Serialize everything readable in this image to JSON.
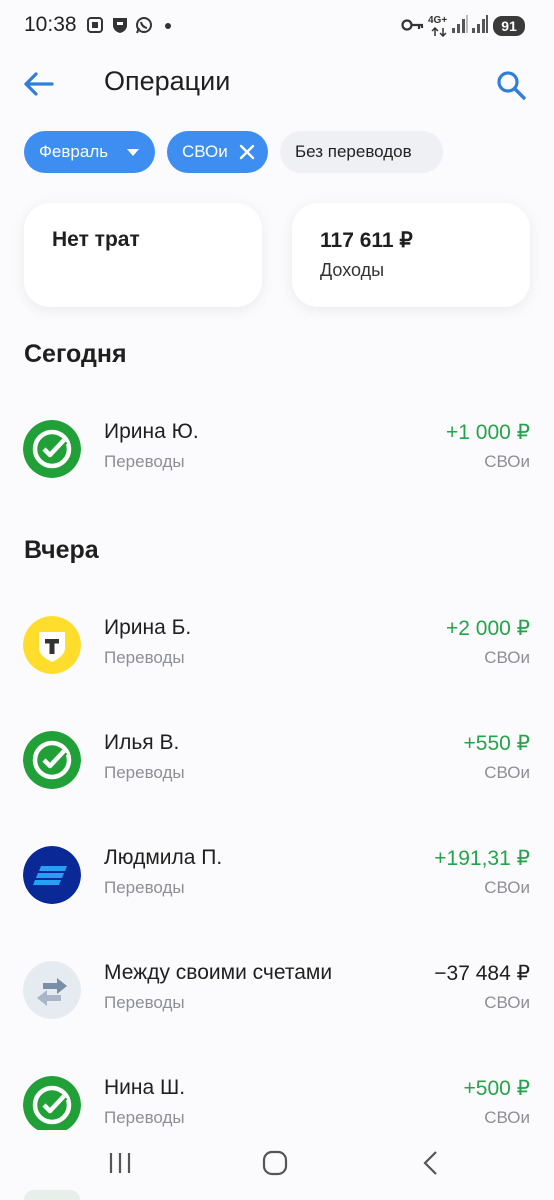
{
  "status_bar": {
    "time": "10:38",
    "network": "4G+",
    "battery": "91"
  },
  "header": {
    "title": "Операции"
  },
  "filters": [
    {
      "label": "Февраль"
    },
    {
      "label": "СВОи"
    },
    {
      "label": "Без переводов"
    }
  ],
  "summary": {
    "expenses": {
      "title": "Нет трат"
    },
    "income": {
      "amount": "117 611 ₽",
      "label": "Доходы"
    }
  },
  "sections": [
    {
      "title": "Сегодня",
      "items": [
        {
          "name": "Ирина Ю.",
          "category": "Переводы",
          "amount": "+1 000 ₽",
          "account": "СВОи",
          "icon": "sber-logo-icon"
        }
      ]
    },
    {
      "title": "Вчера",
      "items": [
        {
          "name": "Ирина Б.",
          "category": "Переводы",
          "amount": "+2 000 ₽",
          "account": "СВОи",
          "icon": "tbank-logo-icon"
        },
        {
          "name": "Илья В.",
          "category": "Переводы",
          "amount": "+550 ₽",
          "account": "СВОи",
          "icon": "sber-logo-icon"
        },
        {
          "name": "Людмила П.",
          "category": "Переводы",
          "amount": "+191,31 ₽",
          "account": "СВОи",
          "icon": "vtb-logo-icon"
        },
        {
          "name": "Между своими счетами",
          "category": "Переводы",
          "amount": "−37 484 ₽",
          "account": "СВОи",
          "icon": "transfer-arrows-icon"
        },
        {
          "name": "Нина Ш.",
          "category": "Переводы",
          "amount": "+500 ₽",
          "account": "СВОи",
          "icon": "sber-logo-icon"
        }
      ]
    }
  ],
  "colors": {
    "accent": "#3d8ef0",
    "positive": "#24a44a",
    "sber": "#21a038",
    "tbank": "#ffdd2d",
    "vtb": "#0a2896",
    "muted": "#8d8f93"
  }
}
